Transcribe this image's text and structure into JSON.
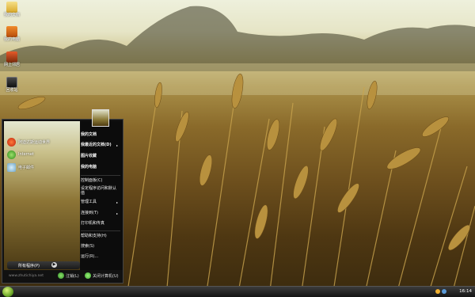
{
  "desktop": {
    "icons": [
      {
        "label": "我的文档",
        "icon": "folder-icon"
      },
      {
        "label": "我的电脑",
        "icon": "computer-icon"
      },
      {
        "label": "网上邻居",
        "icon": "network-icon"
      },
      {
        "label": "回收站",
        "icon": "recycle-bin-icon"
      }
    ]
  },
  "start_menu": {
    "pinned": [
      {
        "label": "阿迪达斯运动世界",
        "icon": "browser-icon"
      },
      {
        "label": "Internet",
        "icon": "internet-icon"
      },
      {
        "label": "电子邮件",
        "icon": "email-icon"
      }
    ],
    "all_programs_label": "所有程序(P)",
    "right_items": [
      {
        "label": "我的文档",
        "bold": true,
        "submenu": false
      },
      {
        "label": "我最近的文档(D)",
        "bold": true,
        "submenu": true
      },
      {
        "label": "图片收藏",
        "bold": true,
        "submenu": false
      },
      {
        "label": "我的电脑",
        "bold": true,
        "submenu": false
      },
      {
        "label": "控制面板(C)",
        "bold": false,
        "submenu": false
      },
      {
        "label": "设定程序访问和默认值",
        "bold": false,
        "submenu": false
      },
      {
        "label": "管理工具",
        "bold": false,
        "submenu": true
      },
      {
        "label": "连接到(T)",
        "bold": false,
        "submenu": true
      },
      {
        "label": "打印机和传真",
        "bold": false,
        "submenu": false
      },
      {
        "label": "帮助和支持(H)",
        "bold": false,
        "submenu": false
      },
      {
        "label": "搜索(S)",
        "bold": false,
        "submenu": false
      },
      {
        "label": "运行(R)...",
        "bold": false,
        "submenu": false
      }
    ],
    "watermark": "www.zhutichiya.net",
    "logoff_label": "注销(L)",
    "shutdown_label": "关闭计算机(U)"
  },
  "taskbar": {
    "clock": "16:14"
  },
  "colors": {
    "accent": "#6da82a",
    "logoff": "#2f8f2a",
    "shutdown": "#3aa82f"
  }
}
